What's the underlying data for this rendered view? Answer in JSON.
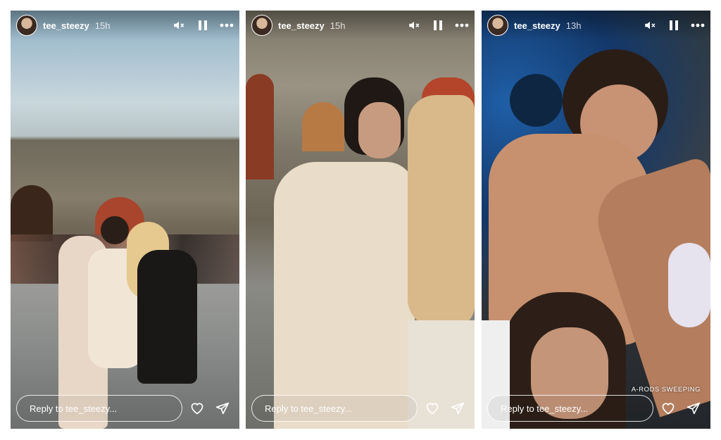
{
  "stories": [
    {
      "username": "tee_steezy",
      "time": "15h",
      "reply_placeholder": "Reply to tee_steezy...",
      "icons": [
        "muted-speaker-icon",
        "pause-icon",
        "more-options-icon",
        "heart-icon",
        "send-icon"
      ]
    },
    {
      "username": "tee_steezy",
      "time": "15h",
      "reply_placeholder": "Reply to tee_steezy...",
      "icons": [
        "muted-speaker-icon",
        "pause-icon",
        "more-options-icon",
        "heart-icon",
        "send-icon"
      ]
    },
    {
      "username": "tee_steezy",
      "time": "13h",
      "reply_placeholder": "Reply to tee_steezy...",
      "caption": "A-RODS SWEEPING",
      "icons": [
        "muted-speaker-icon",
        "pause-icon",
        "more-options-icon",
        "heart-icon",
        "send-icon"
      ]
    }
  ],
  "colors": {
    "ui_text": "#ffffff",
    "page_background": "#ffffff"
  }
}
